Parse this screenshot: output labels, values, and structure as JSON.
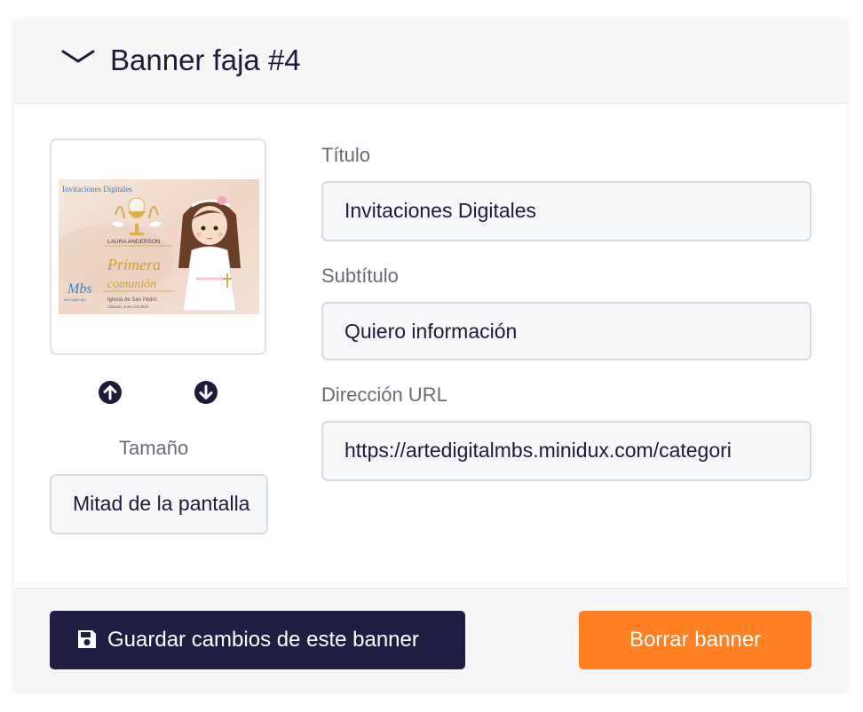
{
  "header": {
    "title": "Banner faja #4"
  },
  "image": {
    "brand": "Invitaciones Digitales",
    "name": "LAURA ANDERSON",
    "headline_1": "Primera",
    "headline_2": "comunión",
    "place": "Iglesia de San Pedro",
    "date": "Sábado, Junio 23 2019",
    "logo": "Mbs",
    "logo_caption": "Arte Digital Mbs"
  },
  "size": {
    "label": "Tamaño",
    "value": "Mitad de la pantalla"
  },
  "form": {
    "title_label": "Título",
    "title_value": "Invitaciones Digitales",
    "subtitle_label": "Subtítulo",
    "subtitle_value": "Quiero información",
    "url_label": "Dirección URL",
    "url_value": "https://artedigitalmbs.minidux.com/categori"
  },
  "footer": {
    "save_label": "Guardar cambios de este banner",
    "delete_label": "Borrar banner"
  },
  "icons": {
    "collapse": "chevron-down-icon",
    "move_up": "arrow-circle-up-icon",
    "move_down": "arrow-circle-down-icon",
    "save": "floppy-disk-icon"
  },
  "colors": {
    "primary": "#1f1d44",
    "danger": "#ff7f22",
    "text": "#1e1b3a",
    "muted": "#6b6b78",
    "input_bg": "#f6f7f9"
  }
}
